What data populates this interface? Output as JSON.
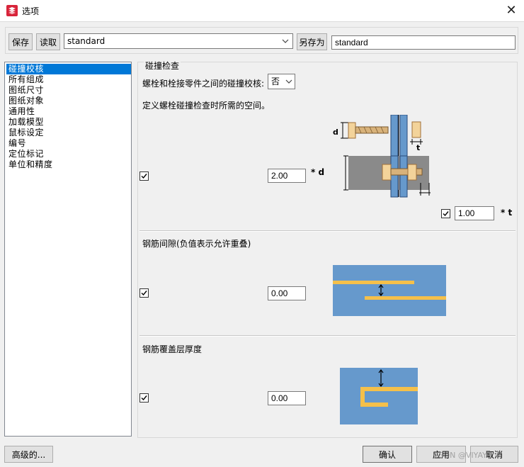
{
  "window": {
    "title": "选项",
    "close_label": "✕"
  },
  "toolbar": {
    "save_label": "保存",
    "load_label": "读取",
    "preset_value": "standard",
    "save_as_label": "另存为",
    "save_as_value": "standard"
  },
  "sidebar": {
    "items": [
      {
        "label": "碰撞校核"
      },
      {
        "label": "所有组成"
      },
      {
        "label": "图纸尺寸"
      },
      {
        "label": "图纸对象"
      },
      {
        "label": "通用性"
      },
      {
        "label": "加载模型"
      },
      {
        "label": "鼠标设定"
      },
      {
        "label": "编号"
      },
      {
        "label": "定位标记"
      },
      {
        "label": "单位和精度"
      }
    ],
    "selected_index": 0
  },
  "clash": {
    "section_title": "碰撞检查",
    "bolt_clash_label": "螺栓和栓接零件之间的碰撞校核:",
    "bolt_clash_value": "否",
    "space_desc": "定义螺栓碰撞检查时所需的空间。",
    "diameter_factor": "2.00",
    "diameter_unit": "* d",
    "thickness_factor": "1.00",
    "thickness_unit": "* t",
    "diagram_label_d": "d",
    "diagram_label_t": "t"
  },
  "rebar_gap": {
    "section_title": "钢筋间隙(负值表示允许重叠)",
    "value": "0.00"
  },
  "rebar_cover": {
    "section_title": "钢筋覆盖层厚度",
    "value": "0.00"
  },
  "footer": {
    "advanced_label": "高级的...",
    "ok_label": "确认",
    "apply_label": "应用",
    "cancel_label": "取消",
    "watermark": "CSDN @VIYAYA"
  },
  "colors": {
    "accent": "#0078d7",
    "diagram_blue": "#6699cc",
    "diagram_gray": "#8a8a8a",
    "rebar_yellow": "#f5c04a"
  }
}
